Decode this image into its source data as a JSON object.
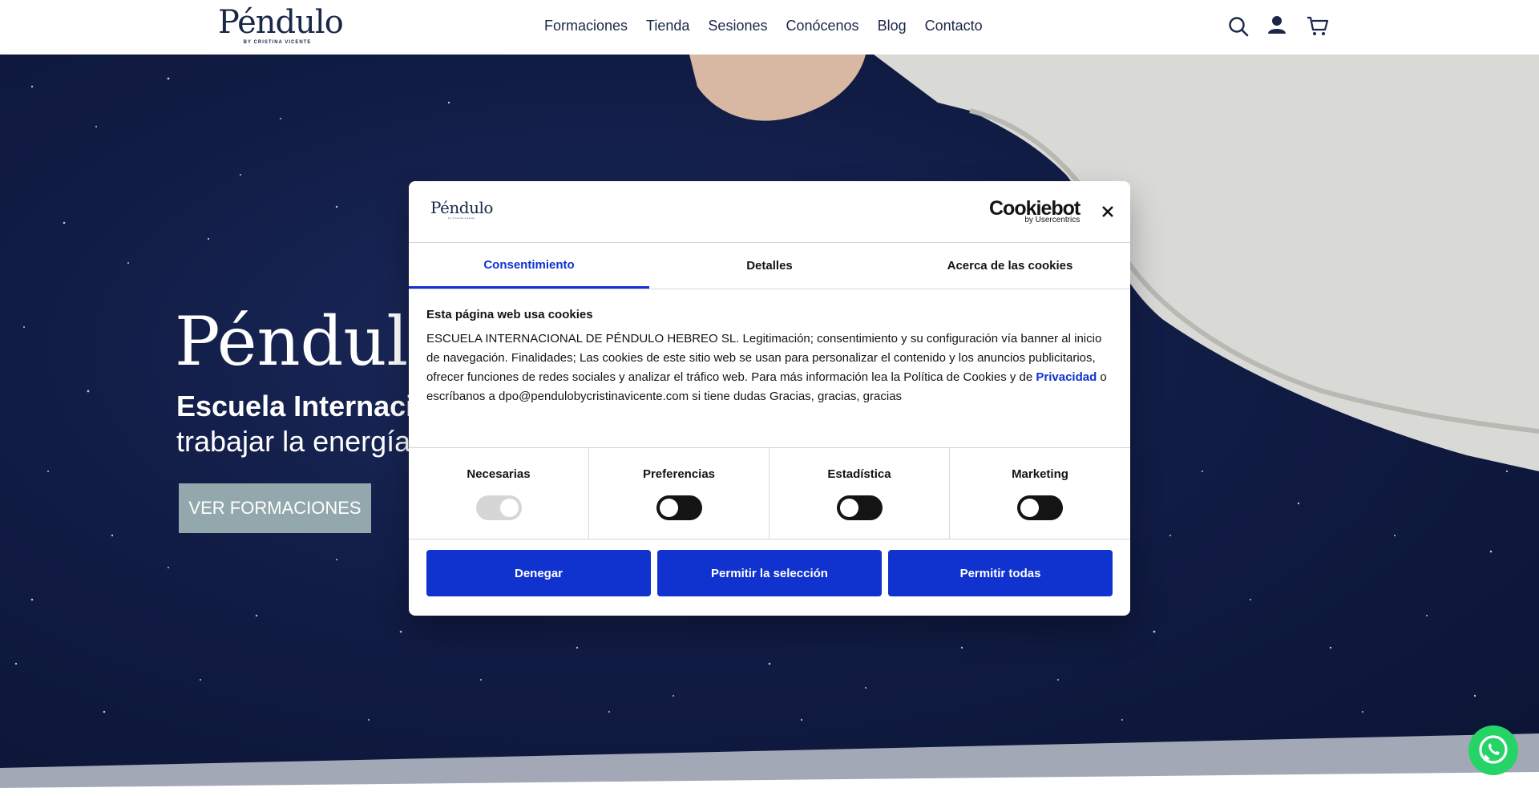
{
  "header": {
    "logo_word": "Péndulo",
    "logo_by": "BY CRISTINA VICENTE",
    "nav": [
      "Formaciones",
      "Tienda",
      "Sesiones",
      "Conócenos",
      "Blog",
      "Contacto"
    ]
  },
  "hero": {
    "title": "Péndulo Hebreo",
    "subtitle1": "Escuela Internacional de Péndulo Hebreo",
    "subtitle2": "trabajar la energía",
    "button": "VER FORMACIONES"
  },
  "modal": {
    "logo_word": "Péndulo",
    "logo_by": "by cristina vicente",
    "cookiebot_main": "Cookiebot",
    "cookiebot_sub": "by Usercentrics",
    "tabs": [
      "Consentimiento",
      "Detalles",
      "Acerca de las cookies"
    ],
    "heading": "Esta página web usa cookies",
    "body_start": "ESCUELA INTERNACIONAL DE PÉNDULO HEBREO SL. Legitimación; consentimiento y su configuración vía banner al inicio de navegación. Finalidades; Las cookies de este sitio web se usan para personalizar el contenido y los anuncios publicitarios, ofrecer funciones de redes sociales y analizar el tráfico web. Para más información lea la Política de Cookies  y de ",
    "privacy_link": "Privacidad",
    "body_end": "  o escríbanos a dpo@pendulobycristinavicente.com si tiene dudas Gracias, gracias, gracias",
    "categories": [
      {
        "label": "Necesarias",
        "checked": true,
        "disabled": true
      },
      {
        "label": "Preferencias",
        "checked": false,
        "disabled": false
      },
      {
        "label": "Estadística",
        "checked": false,
        "disabled": false
      },
      {
        "label": "Marketing",
        "checked": false,
        "disabled": false
      }
    ],
    "buttons": [
      "Denegar",
      "Permitir la selección",
      "Permitir todas"
    ]
  },
  "colors": {
    "brand_navy": "#1a2748",
    "cookie_blue": "#1032cf",
    "hero_button": "#93a8ad",
    "whatsapp": "#25d366"
  },
  "icons": [
    "search-icon",
    "user-icon",
    "cart-icon",
    "close-icon",
    "whatsapp-icon"
  ]
}
